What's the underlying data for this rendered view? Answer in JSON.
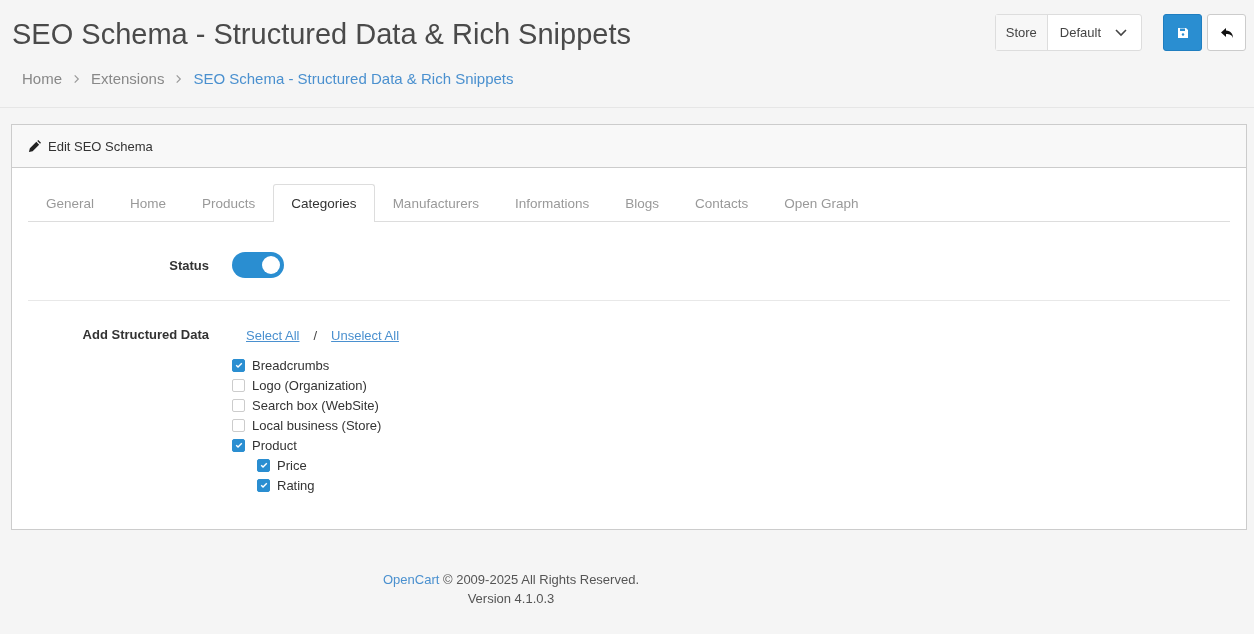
{
  "page": {
    "title": "SEO Schema - Structured Data & Rich Snippets",
    "breadcrumbs": [
      {
        "label": "Home",
        "current": false
      },
      {
        "label": "Extensions",
        "current": false
      },
      {
        "label": "SEO Schema - Structured Data & Rich Snippets",
        "current": true
      }
    ]
  },
  "toolbar": {
    "store_label": "Store",
    "store_value": "Default"
  },
  "panel": {
    "heading": "Edit SEO Schema",
    "tabs": [
      {
        "label": "General",
        "selected": false
      },
      {
        "label": "Home",
        "selected": false
      },
      {
        "label": "Products",
        "selected": false
      },
      {
        "label": "Categories",
        "selected": true
      },
      {
        "label": "Manufacturers",
        "selected": false
      },
      {
        "label": "Informations",
        "selected": false
      },
      {
        "label": "Blogs",
        "selected": false
      },
      {
        "label": "Contacts",
        "selected": false
      },
      {
        "label": "Open Graph",
        "selected": false
      }
    ],
    "status": {
      "label": "Status",
      "on": true
    },
    "structured_data": {
      "label": "Add Structured Data",
      "select_all": "Select All",
      "separator": "/",
      "unselect_all": "Unselect All",
      "items": [
        {
          "label": "Breadcrumbs",
          "checked": true
        },
        {
          "label": "Logo (Organization)",
          "checked": false
        },
        {
          "label": "Search box (WebSite)",
          "checked": false
        },
        {
          "label": "Local business (Store)",
          "checked": false
        },
        {
          "label": "Product",
          "checked": true,
          "children": [
            {
              "label": "Price",
              "checked": true
            },
            {
              "label": "Rating",
              "checked": true
            }
          ]
        }
      ]
    }
  },
  "footer": {
    "link": "OpenCart",
    "text": " © 2009-2025 All Rights Reserved.",
    "version": "Version 4.1.0.3"
  }
}
